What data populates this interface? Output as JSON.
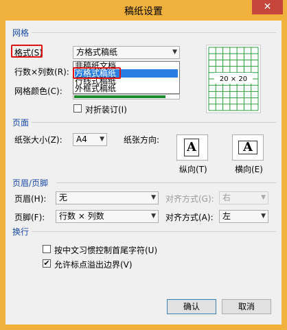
{
  "window": {
    "title": "稿纸设置",
    "close_glyph": "✕"
  },
  "grid": {
    "section_title": "网格",
    "style_label": "格式(S)",
    "style_value": "方格式稿纸",
    "style_options": [
      "非稿纸文档",
      "方格式稿纸",
      "行线式稿纸",
      "外框式稿纸"
    ],
    "style_selected_index": 1,
    "rows_cols_label": "行数×列数(R):",
    "color_label": "网格颜色(C):",
    "fold_label": "对折装订(I)",
    "fold_checked": false,
    "preview_text": "20 × 20",
    "grid_color": "#2a9a3a"
  },
  "page": {
    "section_title": "页面",
    "size_label": "纸张大小(Z):",
    "size_value": "A4",
    "orientation_label": "纸张方向:",
    "portrait_label": "纵向(T)",
    "landscape_label": "横向(E)",
    "orientation_glyph": "A"
  },
  "header_footer": {
    "section_title": "页眉/页脚",
    "header_label": "页眉(H):",
    "header_value": "无",
    "header_align_label": "对齐方式(G):",
    "header_align_value": "右",
    "footer_label": "页脚(F):",
    "footer_value": "行数 × 列数",
    "footer_align_label": "对齐方式(A):",
    "footer_align_value": "左"
  },
  "wrap": {
    "section_title": "换行",
    "opt1_label": "按中文习惯控制首尾字符(U)",
    "opt1_checked": false,
    "opt2_label": "允许标点溢出边界(V)",
    "opt2_checked": true
  },
  "buttons": {
    "ok": "确认",
    "cancel": "取消"
  },
  "check_glyph": "✔"
}
